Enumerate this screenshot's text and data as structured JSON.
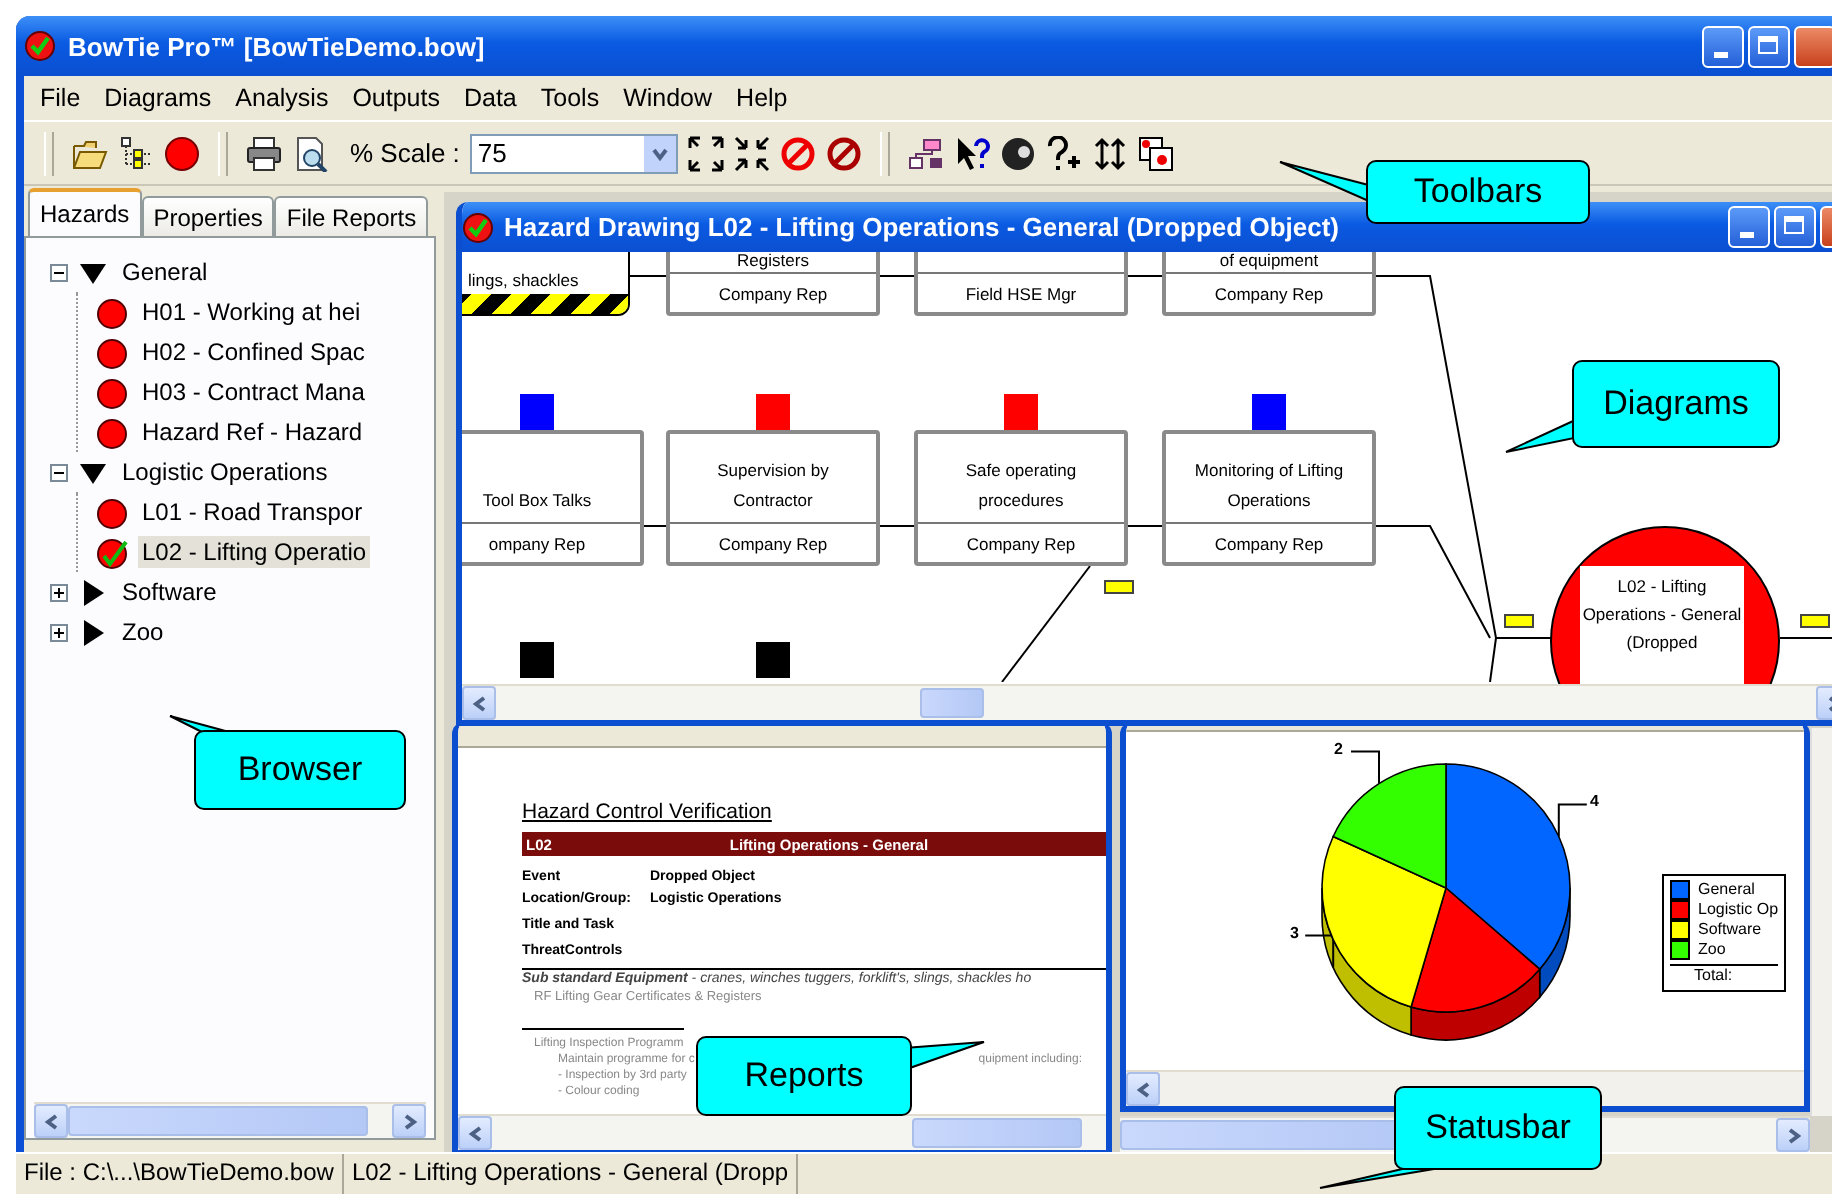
{
  "window": {
    "title": "BowTie Pro™ [BowTieDemo.bow]"
  },
  "menu": [
    "File",
    "Diagrams",
    "Analysis",
    "Outputs",
    "Data",
    "Tools",
    "Window",
    "Help"
  ],
  "toolbar": {
    "scale_label": "% Scale :",
    "scale_value": "75"
  },
  "browser": {
    "tabs": [
      {
        "label": "Hazards",
        "selected": true
      },
      {
        "label": "Properties",
        "selected": false
      },
      {
        "label": "File Reports",
        "selected": false
      }
    ],
    "tree": [
      {
        "label": "General",
        "expanded": true,
        "children": [
          {
            "label": "H01 - Working at hei",
            "selected": false,
            "checked": false
          },
          {
            "label": "H02 - Confined Spac",
            "selected": false,
            "checked": false
          },
          {
            "label": "H03 - Contract Mana",
            "selected": false,
            "checked": false
          },
          {
            "label": "Hazard Ref - Hazard",
            "selected": false,
            "checked": false
          }
        ]
      },
      {
        "label": "Logistic Operations",
        "expanded": true,
        "children": [
          {
            "label": "L01 - Road Transpor",
            "selected": false,
            "checked": false
          },
          {
            "label": "L02 - Lifting Operatio",
            "selected": true,
            "checked": true
          }
        ]
      },
      {
        "label": "Software",
        "expanded": false
      },
      {
        "label": "Zoo",
        "expanded": false
      }
    ]
  },
  "diagram_window": {
    "title": "Hazard Drawing L02 - Lifting Operations - General (Dropped Object)",
    "rows": [
      [
        {
          "kind": "threat",
          "text": "lings, shackles"
        },
        {
          "kind": "control",
          "text": "Registers",
          "owner": "Company Rep"
        },
        {
          "kind": "control",
          "owner": "Field HSE Mgr"
        },
        {
          "kind": "control",
          "text": "of equipment",
          "owner": "Company Rep"
        }
      ],
      [
        {
          "kind": "control",
          "text": "Tool Box Talks",
          "owner": "ompany Rep",
          "color": "#0000ff"
        },
        {
          "kind": "control",
          "text": "Supervision by Contractor",
          "owner": "Company Rep",
          "color": "#ff0000"
        },
        {
          "kind": "control",
          "text": "Safe operating procedures",
          "owner": "Company Rep",
          "color": "#ff0000"
        },
        {
          "kind": "control",
          "text": "Monitoring of Lifting Operations",
          "owner": "Company Rep",
          "color": "#0000ff"
        }
      ],
      [
        {
          "kind": "marker",
          "color": "#000000"
        },
        {
          "kind": "marker",
          "color": "#000000"
        }
      ]
    ],
    "hazard": {
      "text": "L02 - Lifting Operations - General (Dropped"
    }
  },
  "report_window": {
    "title": "Hazard Control Verification",
    "ref": "L02",
    "heading": "Lifting Operations - General",
    "fields": [
      {
        "label": "Event",
        "value": "Dropped Object"
      },
      {
        "label": "Location/Group:",
        "value": "Logistic Operations"
      }
    ],
    "sections": [
      "Title and Task",
      "ThreatControls"
    ],
    "threat": "**Sub standard Equipment** - cranes, winches tuggers, forklift's, slings, shackles ho",
    "control": "RF Lifting Gear Certificates & Registers",
    "detail_title": "Lifting Inspection Programm",
    "detail_left": "Maintain programme for c",
    "detail_right": "quipment including:",
    "bullets": [
      "- Inspection by 3rd party",
      "- Colour coding"
    ]
  },
  "chart_window": {
    "chart_data": {
      "type": "pie",
      "categories": [
        "General",
        "Logistic Op",
        "Software",
        "Zoo"
      ],
      "values": [
        4,
        2,
        3,
        2
      ],
      "value_labels": [
        "4",
        null,
        "3",
        "2"
      ],
      "legend": "right"
    },
    "legend": {
      "items": [
        {
          "color": "#0066ff"
        },
        {
          "color": "#ff0000"
        },
        {
          "color": "#ffff00"
        },
        {
          "color": "#33ff00"
        }
      ],
      "total_label": "Total:"
    }
  },
  "callouts": [
    {
      "text": "Toolbars"
    },
    {
      "text": "Diagrams"
    },
    {
      "text": "Browser"
    },
    {
      "text": "Reports"
    },
    {
      "text": "Statusbar"
    }
  ],
  "status_bar": [
    "File : C:\\...\\BowTieDemo.bow",
    "L02 - Lifting Operations - General (Dropp"
  ]
}
